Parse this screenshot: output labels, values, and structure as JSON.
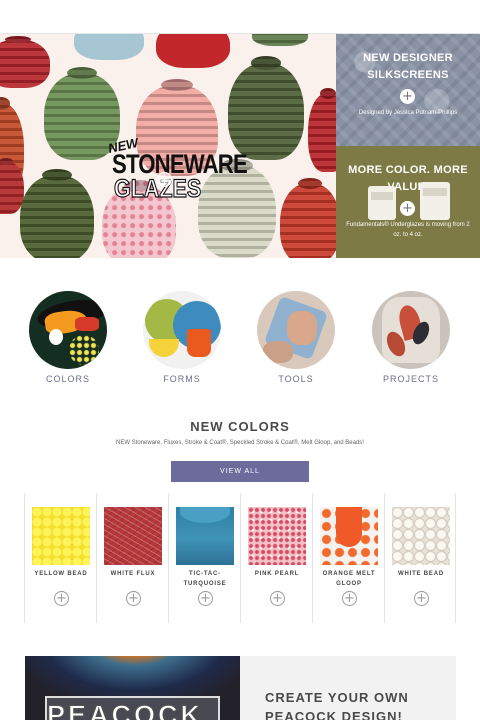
{
  "hero": {
    "new_label": "NEW",
    "title_line1": "STONEWARE",
    "title_line2": "GLAZES"
  },
  "promos": [
    {
      "title_line1": "NEW DESIGNER",
      "title_line2": "SILKSCREENS",
      "subtitle": "Designed by Jessica Putnam-Phillips"
    },
    {
      "title_line1": "MORE COLOR. MORE",
      "title_line2": "VALUE.",
      "subtitle": "Fundamentals® Underglazes is moving from 2 oz. to 4 oz."
    }
  ],
  "categories": [
    {
      "label": "COLORS"
    },
    {
      "label": "FORMS"
    },
    {
      "label": "TOOLS"
    },
    {
      "label": "PROJECTS"
    }
  ],
  "new_colors": {
    "title": "NEW COLORS",
    "subtitle": "NEW Stoneware, Fluxes, Stroke & Coat®, Speckled Stroke & Coat®, Melt Gloop, and Beads!",
    "view_all": "VIEW ALL",
    "products": [
      {
        "name": "YELLOW BEAD"
      },
      {
        "name": "WHITE FLUX"
      },
      {
        "name": "TIC-TAC-TURQUOISE"
      },
      {
        "name": "PINK PEARL"
      },
      {
        "name": "ORANGE MELT GLOOP"
      },
      {
        "name": "WHITE BEAD"
      }
    ]
  },
  "feature": {
    "title_line1": "CREATE YOUR OWN",
    "title_line2": "PEACOCK DESIGN!",
    "image_word": "PEACOCK"
  },
  "icons": {
    "plus": "+"
  }
}
